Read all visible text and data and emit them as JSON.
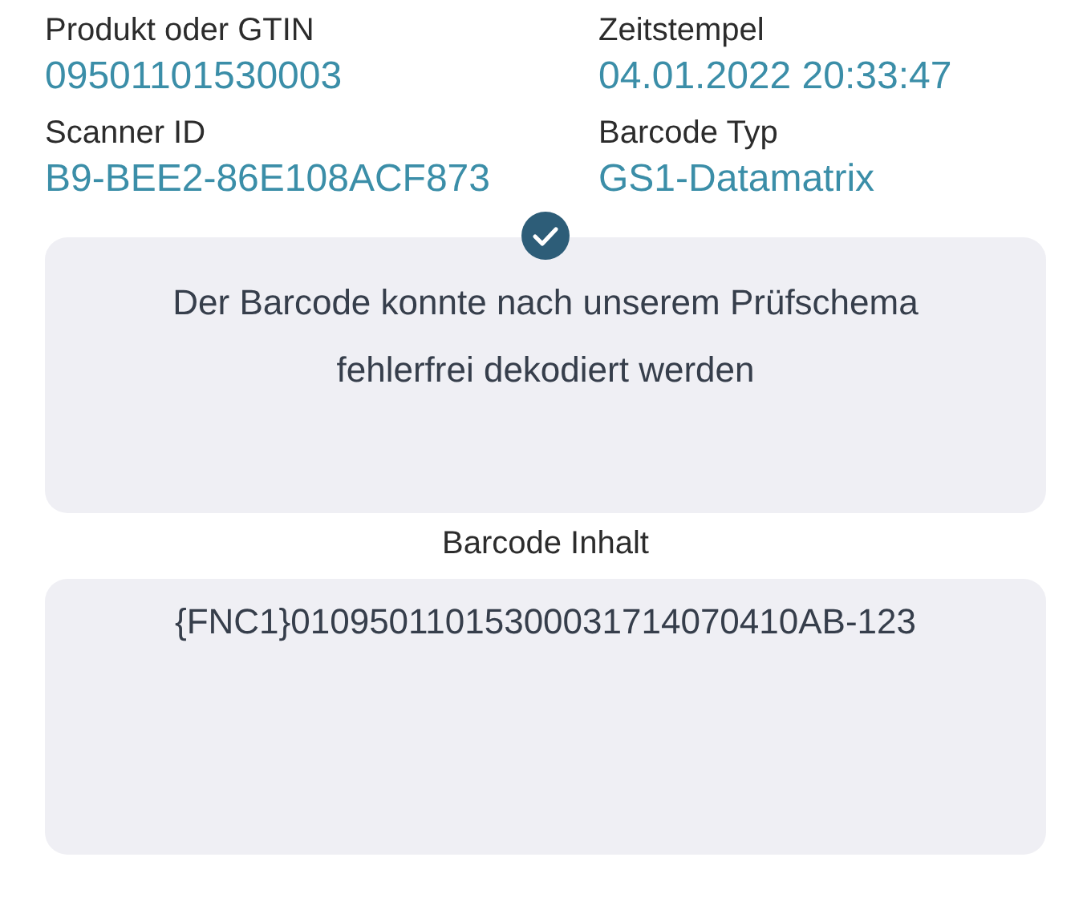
{
  "fields": [
    {
      "label": "Produkt oder GTIN",
      "value": "09501101530003"
    },
    {
      "label": "Zeitstempel",
      "value": "04.01.2022 20:33:47"
    },
    {
      "label": "Scanner ID",
      "value": "B9-BEE2-86E108ACF873"
    },
    {
      "label": "Barcode Typ",
      "value": "GS1-Datamatrix"
    }
  ],
  "verification": {
    "valid": true,
    "message": "Der Barcode konnte nach unserem Prüfschema fehlerfrei dekodiert werden"
  },
  "content": {
    "label": "Barcode Inhalt",
    "value": "{FNC1}01095011015300031714070410AB-123"
  }
}
